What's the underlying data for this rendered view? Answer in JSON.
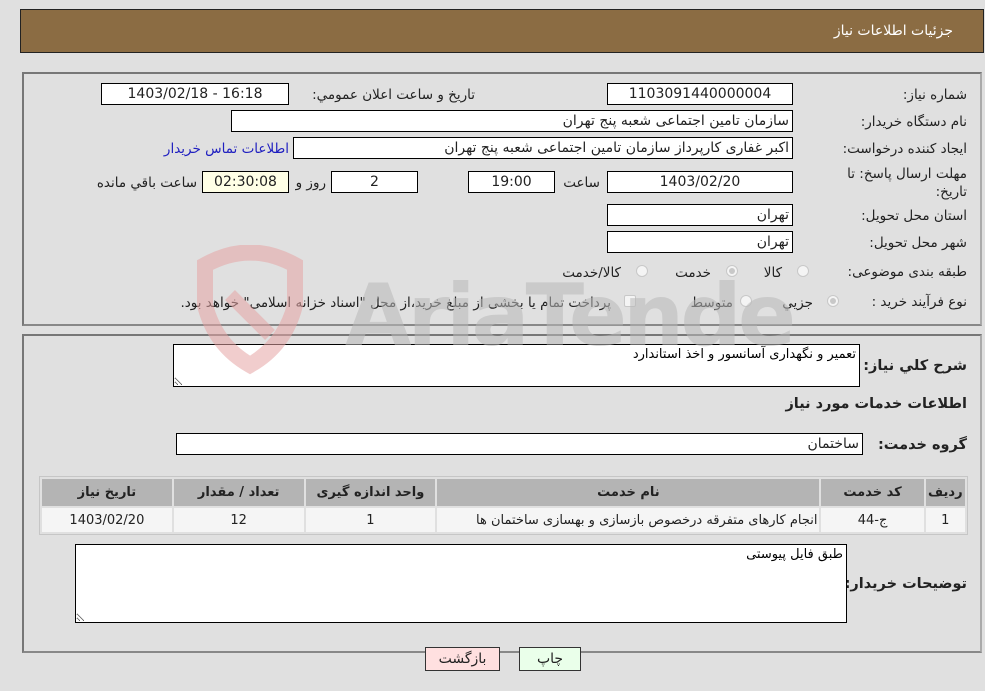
{
  "header": {
    "title": "جزئیات اطلاعات نیاز"
  },
  "form": {
    "need_number": {
      "label": "شماره نیاز:",
      "value": "1103091440000004"
    },
    "announce_datetime": {
      "label": "تاریخ و ساعت اعلان عمومي:",
      "value": "1403/02/18 - 16:18"
    },
    "buyer_org": {
      "label": "نام دستگاه خریدار:",
      "value": "سازمان تامین اجتماعی شعبه پنج تهران"
    },
    "requester": {
      "label": "ایجاد کننده درخواست:",
      "value": "اکبر غفاری کارپرداز  سازمان تامین اجتماعی شعبه پنج تهران"
    },
    "buyer_contact_link": "اطلاعات تماس خریدار",
    "deadline": {
      "label_line1": "مهلت ارسال پاسخ: تا",
      "label_line2": "تاریخ:",
      "date": "1403/02/20",
      "time_label": "ساعت",
      "time": "19:00",
      "days": "2",
      "days_label": "روز و",
      "remaining": "02:30:08",
      "remaining_label": "ساعت باقي مانده"
    },
    "delivery_province": {
      "label": "استان محل تحویل:",
      "value": "تهران"
    },
    "delivery_city": {
      "label": "شهر محل تحویل:",
      "value": "تهران"
    },
    "category": {
      "label": "طبقه بندی موضوعی:",
      "options": [
        "کالا",
        "خدمت",
        "کالا/خدمت"
      ],
      "selected": "خدمت"
    },
    "purchase_process": {
      "label": "نوع فرآیند خرید :",
      "options": [
        "جزيي",
        "متوسط"
      ],
      "selected": "جزيي",
      "treasury_note": "پرداخت تمام یا بخشی از مبلغ خرید،از محل \"اسناد خزانه اسلامی\" خواهد بود."
    }
  },
  "details": {
    "summary_label": "شرح کلي نیاز:",
    "summary_value": "تعمیر و نگهداری آسانسور و اخذ استاندارد",
    "services_heading": "اطلاعات خدمات مورد نیاز",
    "service_group_label": "گروه خدمت:",
    "service_group_value": "ساختمان",
    "table": {
      "headers": [
        "ردیف",
        "کد خدمت",
        "نام خدمت",
        "واحد اندازه گیری",
        "تعداد / مقدار",
        "تاریخ نیاز"
      ],
      "rows": [
        [
          "1",
          "ج-44",
          "انجام کارهای متفرقه درخصوص بازسازی و بهسازی ساختمان ها",
          "1",
          "12",
          "1403/02/20"
        ]
      ]
    },
    "buyer_notes_label": "توضیحات خریدار:",
    "buyer_notes_value": "طبق فایل پیوستی"
  },
  "buttons": {
    "print": "چاپ",
    "back": "بازگشت"
  },
  "colors": {
    "header_bg": "#8b6c43",
    "print_bg": "#eaffea",
    "back_bg": "#ffe0e0",
    "link": "#2020c0"
  }
}
